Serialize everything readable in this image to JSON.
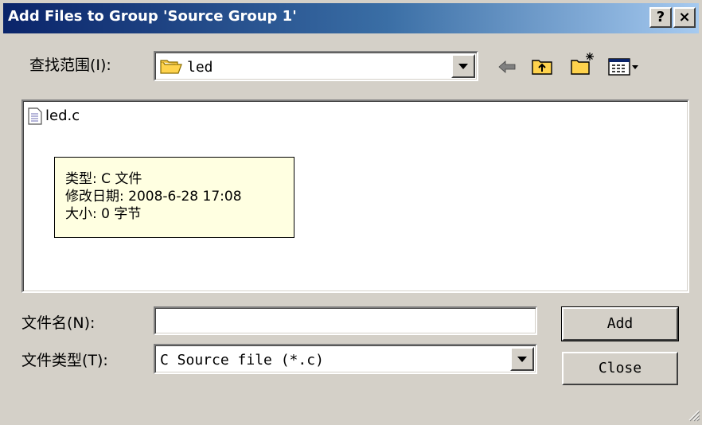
{
  "window": {
    "title": "Add Files to Group 'Source Group 1'",
    "help_label": "?",
    "close_label": "×"
  },
  "lookin": {
    "label": "查找范围(I):",
    "value": "led"
  },
  "file_list": {
    "items": [
      {
        "name": "led.c",
        "icon": "c-file-icon"
      }
    ]
  },
  "tooltip": {
    "lines": [
      "类型: C 文件",
      "修改日期: 2008-6-28 17:08",
      "大小: 0 字节"
    ]
  },
  "filename": {
    "label": "文件名(N):",
    "value": ""
  },
  "filetype": {
    "label": "文件类型(T):",
    "value": "C Source file (*.c)"
  },
  "buttons": {
    "add": "Add",
    "close": "Close"
  },
  "toolbar_icons": [
    "back-arrow-icon",
    "up-folder-icon",
    "new-folder-icon",
    "view-menu-icon"
  ],
  "colors": {
    "titlebar_start": "#0a246a",
    "titlebar_end": "#a6caf0",
    "tooltip_bg": "#ffffe1",
    "dialog_bg": "#d4d0c8"
  }
}
